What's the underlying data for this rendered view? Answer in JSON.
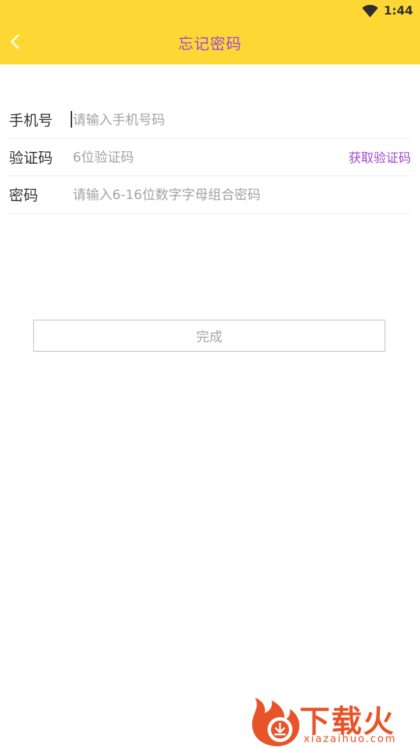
{
  "status_bar": {
    "time": "1:44",
    "icons": [
      "wifi-icon"
    ]
  },
  "header": {
    "title": "忘记密码",
    "back_icon": "chevron-left-icon",
    "background_color": "#fdd835",
    "title_color": "#a04ad1"
  },
  "form": {
    "phone": {
      "label": "手机号",
      "placeholder": "请输入手机号码",
      "value": ""
    },
    "code": {
      "label": "验证码",
      "placeholder": "6位验证码",
      "value": "",
      "action_label": "获取验证码"
    },
    "password": {
      "label": "密码",
      "placeholder": "请输入6-16位数字字母组合密码",
      "value": ""
    }
  },
  "done_button": {
    "label": "完成"
  },
  "watermark": {
    "brand": "下载火",
    "url": "xiazaihuo.com"
  }
}
